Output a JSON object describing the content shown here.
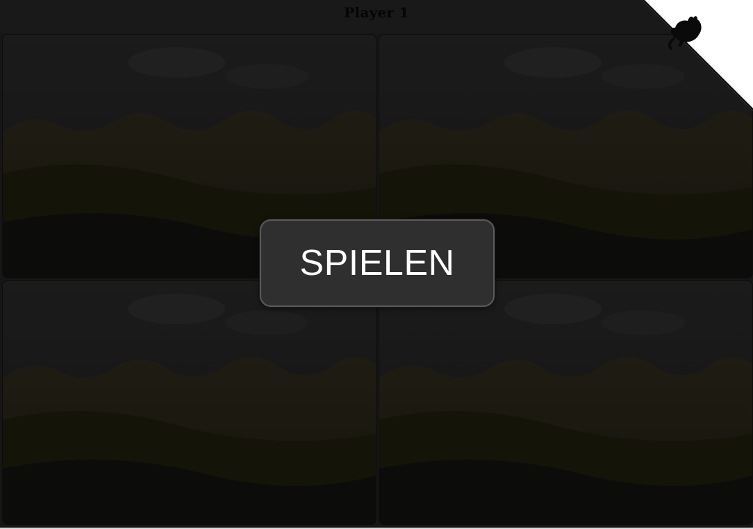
{
  "header": {
    "player_label": "Player 1"
  },
  "boards": [
    {
      "name": "board-top-left"
    },
    {
      "name": "board-top-right"
    },
    {
      "name": "board-bottom-left"
    },
    {
      "name": "board-bottom-right"
    }
  ],
  "overlay": {
    "play_label": "SPIELEN"
  },
  "corner": {
    "icon": "github-octocat-icon"
  },
  "colors": {
    "background": "#161616",
    "button_bg": "#2f2f2f",
    "button_border": "#5a5a5a",
    "button_text": "#ffffff",
    "corner_ribbon": "#ffffff"
  }
}
